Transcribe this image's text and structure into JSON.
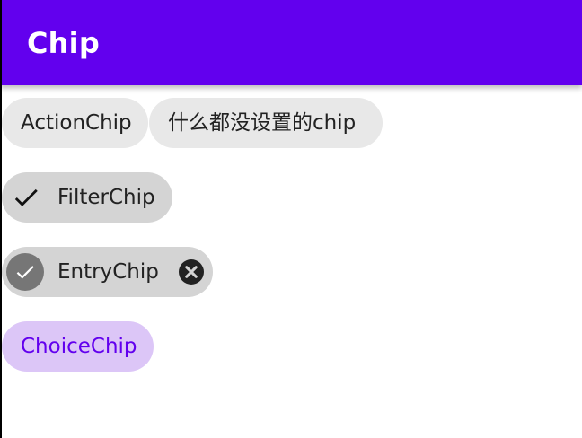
{
  "app_bar": {
    "title": "Chip",
    "background": "#6200ee"
  },
  "chips": {
    "action": {
      "label": "ActionChip",
      "background": "#e8e8e8"
    },
    "plain": {
      "label": "什么都没设置的chip",
      "background": "#e8e8e8"
    },
    "filter": {
      "label": "FilterChip",
      "selected": true,
      "leading_icon": "check-icon",
      "background": "#d4d4d4"
    },
    "entry": {
      "label": "EntryChip",
      "leading_icon": "check-avatar-icon",
      "trailing_icon": "close-icon",
      "background": "#d4d4d4"
    },
    "choice": {
      "label": "ChoiceChip",
      "selected": true,
      "background": "#dcc6f7",
      "text_color": "#6200ee"
    }
  }
}
